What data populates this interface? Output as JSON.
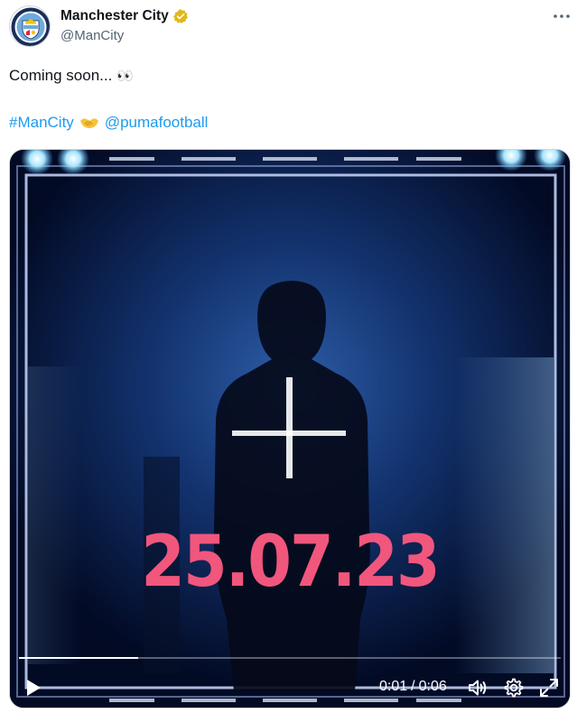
{
  "author": {
    "display_name": "Manchester City",
    "handle": "@ManCity",
    "verified": true,
    "avatar_icon": "manchester-city-crest"
  },
  "more_icon": "more-horizontal-icon",
  "tweet": {
    "text": "Coming soon... ",
    "emoji": "👀",
    "hashtag": "#ManCity",
    "handshake_emoji": "🤝",
    "mention": "@pumafootball"
  },
  "media": {
    "overlay_text": "25.07.23",
    "progress_fraction": 0.22,
    "current_time": "0:01",
    "separator": "/",
    "duration": "0:06",
    "icons": {
      "play": "play-icon",
      "volume": "volume-icon",
      "settings": "settings-gear-icon",
      "fullscreen": "fullscreen-expand-icon"
    }
  },
  "colors": {
    "link": "#1d9bf0",
    "date_pink": "#f1567d",
    "background": "#020a24",
    "city_blue": "#6cabdd",
    "verified_gold": "#e2b719"
  }
}
